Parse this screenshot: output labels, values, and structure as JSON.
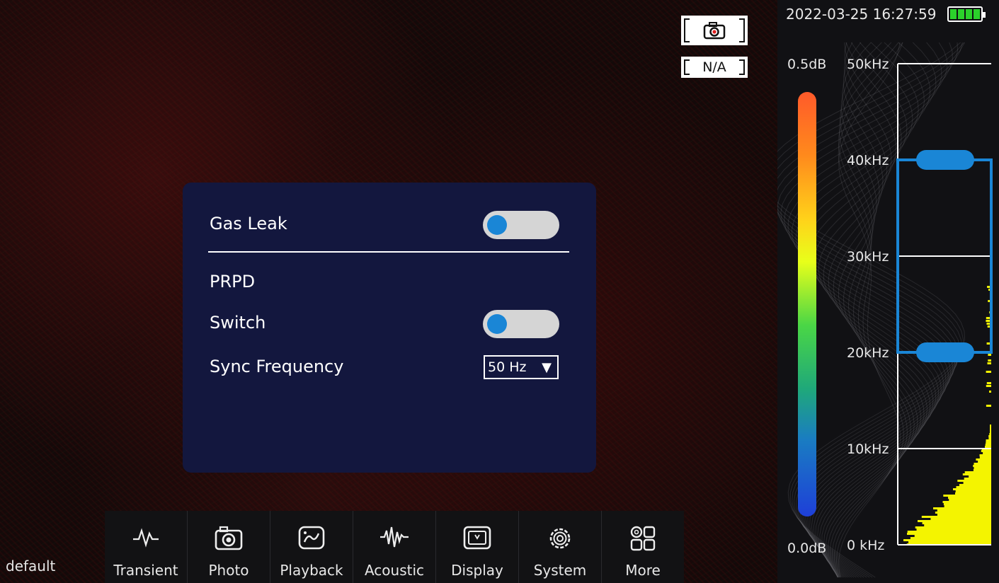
{
  "camera": {
    "na_label": "N/A",
    "profile_label": "default"
  },
  "panel": {
    "gas_leak_label": "Gas Leak",
    "gas_leak_on": false,
    "prpd_label": "PRPD",
    "switch_label": "Switch",
    "switch_on": false,
    "sync_frequency_label": "Sync Frequency",
    "sync_frequency_value": "50 Hz",
    "dropdown_arrow": "▼"
  },
  "toolbar": {
    "items": [
      {
        "label": "Transient",
        "icon": "waveform-icon"
      },
      {
        "label": "Photo",
        "icon": "camera-icon"
      },
      {
        "label": "Playback",
        "icon": "playback-icon"
      },
      {
        "label": "Acoustic",
        "icon": "acoustic-wave-icon"
      },
      {
        "label": "Display",
        "icon": "display-icon"
      },
      {
        "label": "System",
        "icon": "gear-icon"
      },
      {
        "label": "More",
        "icon": "grid-icon"
      }
    ]
  },
  "status": {
    "datetime": "2022-03-25 16:27:59",
    "battery_level": 1.0
  },
  "scale": {
    "db_max": "0.5dB",
    "db_min": "0.0dB",
    "freq_labels": [
      "50kHz",
      "40kHz",
      "30kHz",
      "20kHz",
      "10kHz",
      "0 kHz"
    ],
    "filter_band_khz": [
      20,
      40
    ]
  },
  "colors": {
    "panel_bg": "#13173e",
    "toggle_knob": "#1a86d6",
    "band_handle": "#1a86d6",
    "histogram": "#f4f400"
  }
}
